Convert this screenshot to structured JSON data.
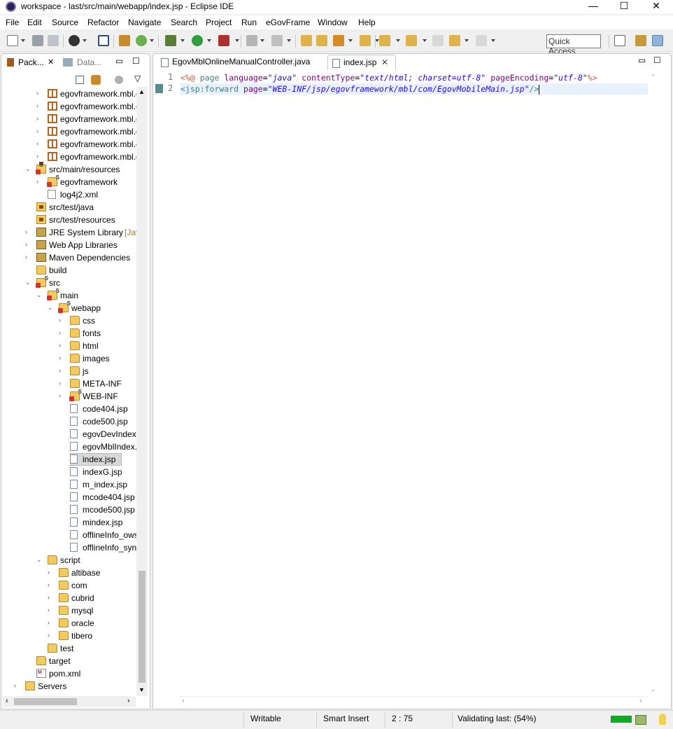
{
  "window": {
    "title": "workspace - last/src/main/webapp/index.jsp - Eclipse IDE",
    "minimize": "—",
    "maximize": "☐",
    "close": "✕"
  },
  "menu": [
    "File",
    "Edit",
    "Source",
    "Refactor",
    "Navigate",
    "Search",
    "Project",
    "Run",
    "eGovFrame",
    "Window",
    "Help"
  ],
  "toolbar": {
    "quick_access": "Quick Access"
  },
  "left_panel": {
    "tabs": [
      {
        "label": "Pack...",
        "close": "✕"
      },
      {
        "label": "Data..."
      }
    ],
    "minimize": "▭",
    "maximize": "☐",
    "view_menu": "▽"
  },
  "tree": [
    {
      "label": "egovframework.mbl.c",
      "icon": "package-icon",
      "arrow": "›",
      "depth": 2
    },
    {
      "label": "egovframework.mbl.c",
      "icon": "package-icon",
      "arrow": "›",
      "depth": 2
    },
    {
      "label": "egovframework.mbl.c",
      "icon": "package-icon",
      "arrow": "›",
      "depth": 2
    },
    {
      "label": "egovframework.mbl.c",
      "icon": "package-icon",
      "arrow": "›",
      "depth": 2
    },
    {
      "label": "egovframework.mbl.c",
      "icon": "package-icon",
      "arrow": "›",
      "depth": 2
    },
    {
      "label": "egovframework.mbl.c",
      "icon": "package-icon",
      "arrow": "›",
      "depth": 2
    },
    {
      "label": "src/main/resources",
      "icon": "source-folder-error-icon",
      "arrow": "⌄",
      "depth": 1
    },
    {
      "label": "egovframework",
      "icon": "folder-error-icon",
      "arrow": "›",
      "depth": 2
    },
    {
      "label": "log4j2.xml",
      "icon": "xml-file-icon",
      "arrow": "",
      "depth": 2
    },
    {
      "label": "src/test/java",
      "icon": "source-folder-icon",
      "arrow": "",
      "depth": 1
    },
    {
      "label": "src/test/resources",
      "icon": "source-folder-icon",
      "arrow": "",
      "depth": 1
    },
    {
      "label": "JRE System Library",
      "suffix": "[JavaS",
      "icon": "library-icon",
      "arrow": "›",
      "depth": 1
    },
    {
      "label": "Web App Libraries",
      "icon": "library-icon",
      "arrow": "›",
      "depth": 1
    },
    {
      "label": "Maven Dependencies",
      "icon": "library-icon",
      "arrow": "›",
      "depth": 1
    },
    {
      "label": "build",
      "icon": "folder-icon",
      "arrow": "",
      "depth": 1
    },
    {
      "label": "src",
      "icon": "folder-error-icon",
      "arrow": "⌄",
      "depth": 1
    },
    {
      "label": "main",
      "icon": "folder-error-icon",
      "arrow": "⌄",
      "depth": 2
    },
    {
      "label": "webapp",
      "icon": "folder-error-icon",
      "arrow": "⌄",
      "depth": 3
    },
    {
      "label": "css",
      "icon": "folder-icon",
      "arrow": "›",
      "depth": 4
    },
    {
      "label": "fonts",
      "icon": "folder-icon",
      "arrow": "›",
      "depth": 4
    },
    {
      "label": "html",
      "icon": "folder-icon",
      "arrow": "›",
      "depth": 4
    },
    {
      "label": "images",
      "icon": "folder-icon",
      "arrow": "›",
      "depth": 4
    },
    {
      "label": "js",
      "icon": "folder-icon",
      "arrow": "›",
      "depth": 4
    },
    {
      "label": "META-INF",
      "icon": "folder-icon",
      "arrow": "›",
      "depth": 4
    },
    {
      "label": "WEB-INF",
      "icon": "folder-error-icon",
      "arrow": "›",
      "depth": 4
    },
    {
      "label": "code404.jsp",
      "icon": "file-icon",
      "arrow": "",
      "depth": 4
    },
    {
      "label": "code500.jsp",
      "icon": "file-icon",
      "arrow": "",
      "depth": 4
    },
    {
      "label": "egovDevIndex.js",
      "icon": "file-icon",
      "arrow": "",
      "depth": 4
    },
    {
      "label": "egovMblIndex.js",
      "icon": "file-icon",
      "arrow": "",
      "depth": 4
    },
    {
      "label": "index.jsp",
      "icon": "file-icon",
      "arrow": "",
      "depth": 4,
      "selected": true
    },
    {
      "label": "indexG.jsp",
      "icon": "file-icon",
      "arrow": "",
      "depth": 4
    },
    {
      "label": "m_index.jsp",
      "icon": "file-icon",
      "arrow": "",
      "depth": 4
    },
    {
      "label": "mcode404.jsp",
      "icon": "file-icon",
      "arrow": "",
      "depth": 4
    },
    {
      "label": "mcode500.jsp",
      "icon": "file-icon",
      "arrow": "",
      "depth": 4
    },
    {
      "label": "mindex.jsp",
      "icon": "file-icon",
      "arrow": "",
      "depth": 4
    },
    {
      "label": "offlineInfo_ows.",
      "icon": "file-icon",
      "arrow": "",
      "depth": 4
    },
    {
      "label": "offlineInfo_sync",
      "icon": "file-icon",
      "arrow": "",
      "depth": 4
    },
    {
      "label": "script",
      "icon": "folder-icon",
      "arrow": "⌄",
      "depth": 2
    },
    {
      "label": "altibase",
      "icon": "folder-icon",
      "arrow": "›",
      "depth": 3
    },
    {
      "label": "com",
      "icon": "folder-icon",
      "arrow": "›",
      "depth": 3
    },
    {
      "label": "cubrid",
      "icon": "folder-icon",
      "arrow": "›",
      "depth": 3
    },
    {
      "label": "mysql",
      "icon": "folder-icon",
      "arrow": "›",
      "depth": 3
    },
    {
      "label": "oracle",
      "icon": "folder-icon",
      "arrow": "›",
      "depth": 3
    },
    {
      "label": "tibero",
      "icon": "folder-icon",
      "arrow": "›",
      "depth": 3
    },
    {
      "label": "test",
      "icon": "folder-icon",
      "arrow": "",
      "depth": 2
    },
    {
      "label": "target",
      "icon": "folder-icon",
      "arrow": "",
      "depth": 1
    },
    {
      "label": "pom.xml",
      "icon": "maven-file-icon",
      "arrow": "",
      "depth": 1
    },
    {
      "label": "Servers",
      "icon": "servers-folder-icon",
      "arrow": "›",
      "depth": 0
    }
  ],
  "editor": {
    "tabs": [
      {
        "label": "EgovMblOnlineManualController.java",
        "active": false
      },
      {
        "label": "index.jsp",
        "active": true,
        "close": "✕"
      }
    ],
    "minimize": "▭",
    "maximize": "☐",
    "lines": [
      {
        "number": "1",
        "tokens": [
          {
            "t": "delim",
            "v": "<%@ "
          },
          {
            "t": "tag",
            "v": "page "
          },
          {
            "t": "attr",
            "v": "language"
          },
          {
            "t": "plain",
            "v": "="
          },
          {
            "t": "val",
            "v": "\"java\""
          },
          {
            "t": "plain",
            "v": " "
          },
          {
            "t": "attr",
            "v": "contentType"
          },
          {
            "t": "plain",
            "v": "="
          },
          {
            "t": "val",
            "v": "\"text/html; charset=utf-8\""
          },
          {
            "t": "plain",
            "v": " "
          },
          {
            "t": "attr",
            "v": "pageEncoding"
          },
          {
            "t": "plain",
            "v": "="
          },
          {
            "t": "val",
            "v": "\"utf-8\""
          },
          {
            "t": "delim",
            "v": "%>"
          }
        ]
      },
      {
        "number": "2",
        "current": true,
        "tokens": [
          {
            "t": "tag",
            "v": "<jsp:forward "
          },
          {
            "t": "attr",
            "v": "page"
          },
          {
            "t": "plain",
            "v": "="
          },
          {
            "t": "val",
            "v": "\"WEB-INF/jsp/egovframework/mbl/com/EgovMobileMain.jsp\""
          },
          {
            "t": "tag",
            "v": "/>"
          }
        ]
      }
    ]
  },
  "status": {
    "writable": "Writable",
    "insert_mode": "Smart Insert",
    "position": "2 : 75",
    "job": "Validating last: (54%)",
    "job_progress": 0.54
  },
  "colors": {
    "code_tag": "#3f7f7f",
    "code_attr": "#7f007f",
    "code_value": "#2a00ff",
    "code_delim": "#bf5f3f",
    "current_line": "#e8f2fe",
    "progress": "#06b025"
  }
}
